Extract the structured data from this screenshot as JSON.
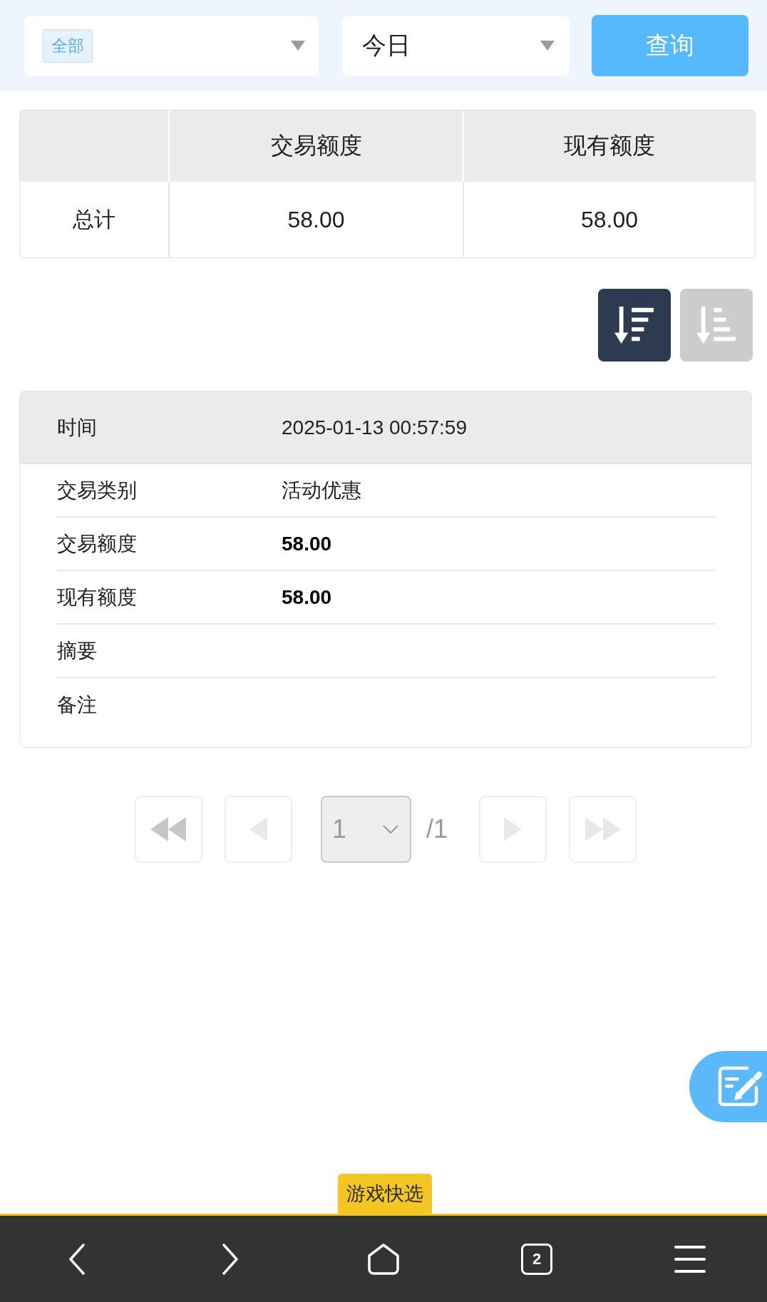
{
  "filters": {
    "category": {
      "tags": [
        "全部"
      ]
    },
    "period": {
      "value": "今日"
    },
    "query_button": "查询"
  },
  "summary_table": {
    "columns": [
      "交易额度",
      "现有额度"
    ],
    "rows": [
      {
        "label": "总计",
        "cells": [
          "58.00",
          "58.00"
        ]
      }
    ]
  },
  "sort_buttons": [
    {
      "kind": "descending",
      "selected": true
    },
    {
      "kind": "ascending",
      "selected": false
    }
  ],
  "record": {
    "header": {
      "label": "时间",
      "value": "2025-01-13 00:57:59"
    },
    "fields": [
      {
        "label": "交易类别",
        "value": "活动优惠",
        "kind": "text"
      },
      {
        "label": "交易额度",
        "value": "58.00",
        "kind": "amount"
      },
      {
        "label": "现有额度",
        "value": "58.00",
        "kind": "amount"
      },
      {
        "label": "摘要"
      },
      {
        "label": "备注"
      }
    ]
  },
  "pagination": {
    "first": {
      "disabled": false
    },
    "previous": {
      "disabled": true
    },
    "page_select": {
      "value": "1",
      "disabled": true
    },
    "total": "/1",
    "next": {
      "disabled": true
    },
    "last": {
      "disabled": true
    }
  },
  "browser": {
    "promo_tab": "游戏快选",
    "tab_count": "2"
  }
}
